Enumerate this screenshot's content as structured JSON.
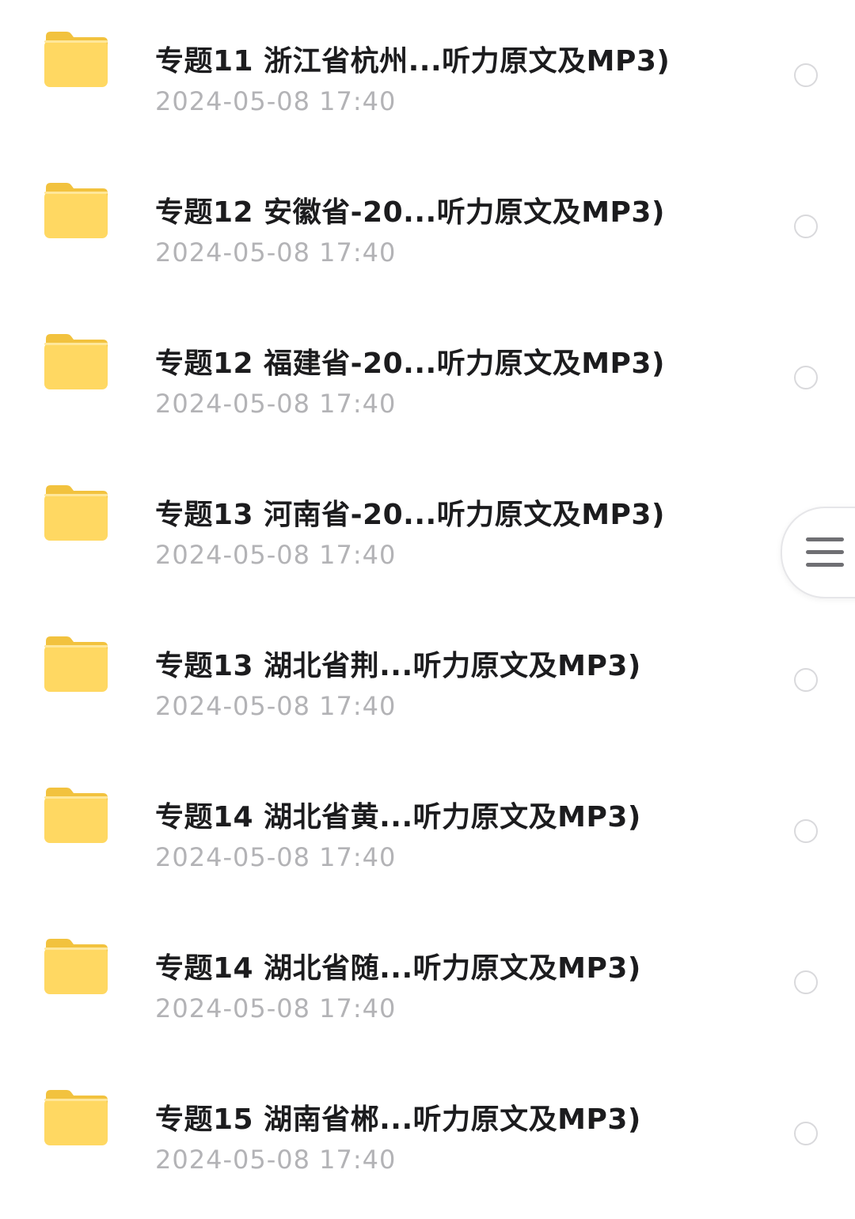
{
  "files": [
    {
      "name": "专题11 浙江省杭州...听力原文及MP3)",
      "date": "2024-05-08 17:40"
    },
    {
      "name": "专题12 安徽省-20...听力原文及MP3)",
      "date": "2024-05-08 17:40"
    },
    {
      "name": "专题12 福建省-20...听力原文及MP3)",
      "date": "2024-05-08 17:40"
    },
    {
      "name": "专题13 河南省-20...听力原文及MP3)",
      "date": "2024-05-08 17:40"
    },
    {
      "name": "专题13 湖北省荆...听力原文及MP3)",
      "date": "2024-05-08 17:40"
    },
    {
      "name": "专题14 湖北省黄...听力原文及MP3)",
      "date": "2024-05-08 17:40"
    },
    {
      "name": "专题14 湖北省随...听力原文及MP3)",
      "date": "2024-05-08 17:40"
    },
    {
      "name": "专题15 湖南省郴...听力原文及MP3)",
      "date": "2024-05-08 17:40"
    }
  ],
  "icons": {
    "folder": "folder-icon",
    "select": "radio-circle",
    "menu": "hamburger-menu-icon"
  },
  "colors": {
    "folder_front": "#FFD75E",
    "folder_back": "#F5C544",
    "date_text": "#B3B3B6",
    "title_text": "#1C1C1E"
  }
}
